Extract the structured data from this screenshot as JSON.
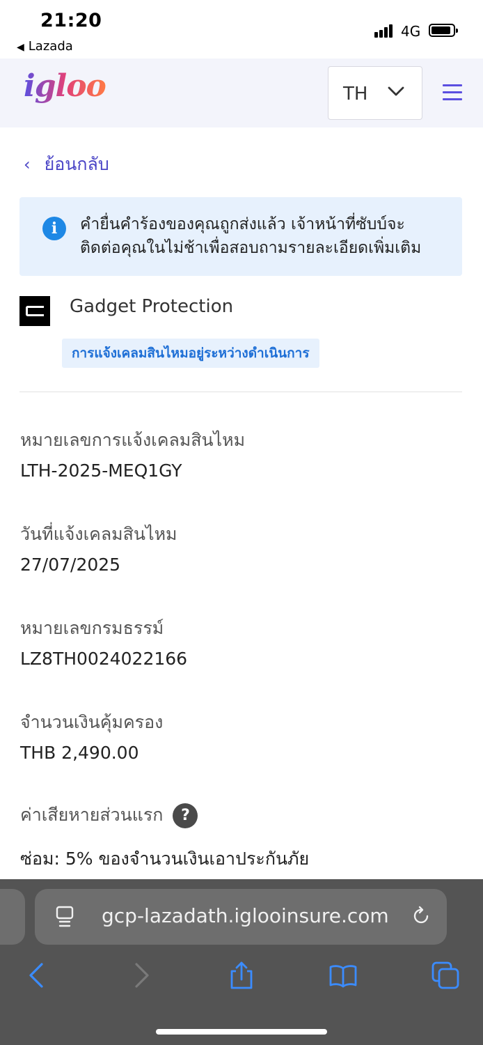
{
  "status_bar": {
    "time": "21:20",
    "back_app": "Lazada",
    "network": "4G"
  },
  "header": {
    "logo_text": "igloo",
    "language": "TH",
    "icons": [
      "chevron-down-icon",
      "hamburger-menu-icon"
    ],
    "accent_color": "#5b4fe0"
  },
  "nav": {
    "back_label": "ย้อนกลับ"
  },
  "notice": {
    "message": "คำยื่นคำร้องของคุณถูกส่งแล้ว เจ้าหน้าที่ซับบ์จะติดต่อคุณในไม่ช้าเพื่อสอบถามรายละเอียดเพิ่มเติม",
    "icon": "info-icon",
    "color": "#1e88e5"
  },
  "product": {
    "name": "Gadget Protection",
    "status": "การแจ้งเคลมสินไหมอยู่ระหว่างดำเนินการ"
  },
  "fields": [
    {
      "label": "หมายเลขการแจ้งเคลมสินไหม",
      "value": "LTH-2025-MEQ1GY"
    },
    {
      "label": "วันที่แจ้งเคลมสินไหม",
      "value": "27/07/2025"
    },
    {
      "label": "หมายเลขกรมธรรม์",
      "value": "LZ8TH0024022166"
    },
    {
      "label": "จำนวนเงินคุ้มครอง",
      "value": "THB 2,490.00"
    }
  ],
  "deductible": {
    "label": "ค่าเสียหายส่วนแรก",
    "help": "?",
    "repair_text": "ซ่อม: 5% ของจำนวนเงินเอาประกันภัย"
  },
  "browser": {
    "url": "gcp-lazadath.iglooinsure.com",
    "icons": [
      "page-icon",
      "reload-icon",
      "back-icon",
      "forward-icon",
      "share-icon",
      "bookmarks-icon",
      "tabs-icon"
    ]
  }
}
